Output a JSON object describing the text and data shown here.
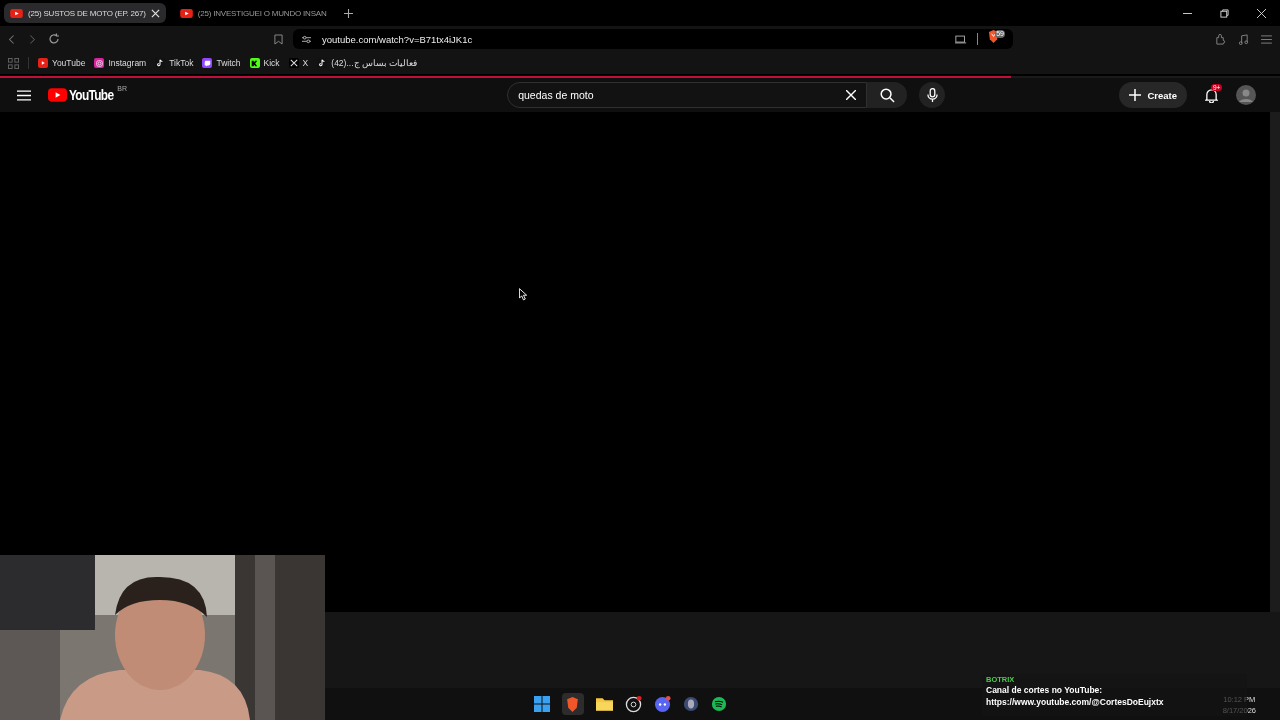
{
  "tabs": [
    {
      "title": "(25) SUSTOS DE MOTO (EP. 267)",
      "selected": true
    },
    {
      "title": "(25) INVESTIGUEI O MUNDO INSAN",
      "selected": false
    }
  ],
  "address": "youtube.com/watch?v=B71tx4iJK1c",
  "shield_count": "59",
  "bookmarks": [
    {
      "kind": "youtube",
      "label": "YouTube"
    },
    {
      "kind": "instagram",
      "label": "Instagram"
    },
    {
      "kind": "tiktok",
      "label": "TikTok"
    },
    {
      "kind": "twitch",
      "label": "Twitch"
    },
    {
      "kind": "kick",
      "label": "Kick"
    },
    {
      "kind": "x",
      "label": "X"
    },
    {
      "kind": "tiktok",
      "label": "فعاليات بساس ج...(42)"
    }
  ],
  "youtube": {
    "logo_text": "YouTube",
    "country": "BR",
    "search": "quedas de moto",
    "create": "Create",
    "notifications": "9+",
    "loading": {
      "level": 0.79
    }
  },
  "chat_overlay": {
    "source": "BOTRIX",
    "lines": [
      "Canal de cortes no YouTube:",
      "https://www.youtube.com/@CortesDoEujxtx"
    ]
  },
  "clock": {
    "time": "10:12 PM",
    "date": "8/17/2026"
  }
}
